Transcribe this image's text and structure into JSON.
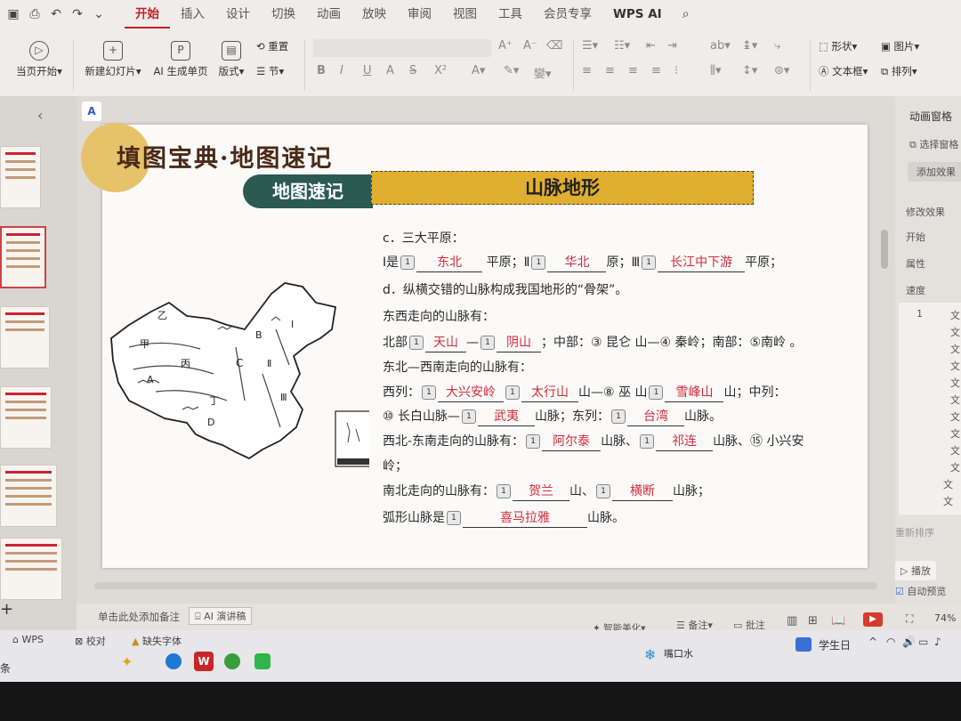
{
  "toolbar": {
    "tabs": [
      "开始",
      "插入",
      "设计",
      "切换",
      "动画",
      "放映",
      "审阅",
      "视图",
      "工具",
      "会员专享",
      "WPS AI"
    ],
    "active_tab": "开始",
    "buttons": {
      "play_from_current": "当页开始",
      "new_slide": "新建幻灯片",
      "ai_slide": "AI 生成单页",
      "layout": "版式",
      "reset": "重置",
      "section": "节",
      "shape": "形状",
      "picture": "图片",
      "textbox": "文本框",
      "arrange": "排列"
    }
  },
  "right_panel": {
    "title": "动画窗格",
    "select_pane": "选择窗格",
    "add_effect": "添加效果",
    "modify_effect": "修改效果",
    "start_label": "开始",
    "property_label": "属性",
    "speed_label": "速度",
    "list_first_index": "1",
    "list_item": "文",
    "reorder": "重新排序",
    "play_btn": "播放",
    "auto_preview": "自动预览"
  },
  "slide": {
    "title": "填图宝典·地图速记",
    "banner_left": "地图速记",
    "banner_right": "山脉地形",
    "badge": "1",
    "lines": {
      "c_title": "c．三大平原：",
      "c1_pre": "Ⅰ是",
      "c1_ans1": "东北",
      "c1_mid1": "平原；Ⅱ",
      "c1_ans2": "华北",
      "c1_mid2": "原；Ⅲ",
      "c1_ans3": "长江中下游",
      "c1_end": "平原；",
      "d_title": "d．纵横交错的山脉构成我国地形的“骨架”。",
      "ew_title": "东西走向的山脉有：",
      "n_pre": "北部",
      "n_ans1": "天山",
      "n_dash": "—",
      "n_ans2": "阴山",
      "n_rest": "；中部：③ 昆仑 山—④ 秦岭；南部：⑤南岭 。",
      "ne_title": "东北—西南走向的山脉有：",
      "w_pre": "西列：",
      "w_ans1": "大兴安岭",
      "w_ans2": "太行山",
      "w_mid": "山—⑧ 巫 山",
      "w_ans3": "雪峰山",
      "w_end": "山；中列：",
      "m_pre": "⑩ 长白山脉—",
      "m_ans1": "武夷",
      "m_mid": "山脉；东列：",
      "m_ans2": "台湾",
      "m_end": "山脉。",
      "nw_pre": "西北-东南走向的山脉有：",
      "nw_ans1": "阿尔泰",
      "nw_mid1": "山脉、",
      "nw_ans2": "祁连",
      "nw_mid2": "山脉、⑮ 小兴安",
      "nw_cont": "岭；",
      "ns_pre": "南北走向的山脉有：",
      "ns_ans1": "贺兰",
      "ns_mid": "山、",
      "ns_ans2": "横断",
      "ns_end": "山脉；",
      "arc_pre": "弧形山脉是",
      "arc_ans": "喜马拉雅",
      "arc_end": "山脉。"
    },
    "map_labels": [
      "乙",
      "甲",
      "丙",
      "A",
      "B",
      "C",
      "D",
      "丁",
      "Ⅰ",
      "Ⅱ",
      "Ⅲ"
    ]
  },
  "status": {
    "notes_hint": "单击此处添加备注",
    "ai_script": "AI 演讲稿",
    "smart_beautify": "智能美化",
    "notes": "备注",
    "comment": "批注",
    "zoom": "74%",
    "wps": "WPS",
    "proofread": "校对",
    "missing_font": "缺失字体"
  },
  "taskbar": {
    "weather": "嘴口水",
    "date_label": "学生日",
    "left_char": "条"
  },
  "colors": {
    "accent": "#c21f1f",
    "answer": "#d22b3c",
    "banner_green": "#2b5a51",
    "banner_gold": "#e0ae30"
  }
}
